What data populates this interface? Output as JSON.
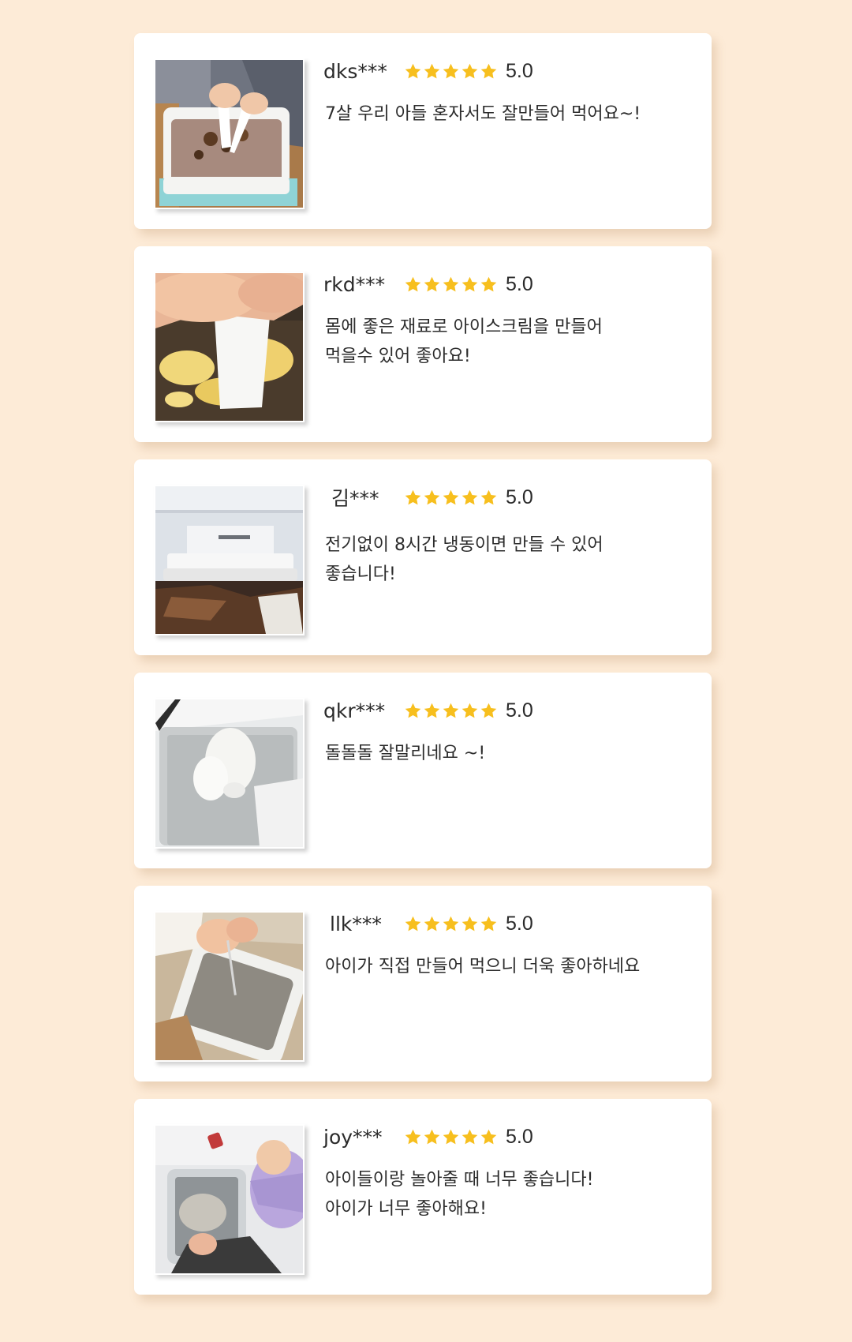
{
  "reviews": [
    {
      "username": "dks***",
      "rating": "5.0",
      "stars": 5,
      "lines": [
        "7살 우리 아들 혼자서도 잘만들어 먹어요~!"
      ],
      "photo": "kids-scooping-chocolate-ice-cream"
    },
    {
      "username": "rkd***",
      "rating": "5.0",
      "stars": 5,
      "lines": [
        "몸에 좋은 재료로 아이스크림을 만들어",
        "먹을수 있어 좋아요!"
      ],
      "photo": "hand-scraping-vanilla-ice-cream"
    },
    {
      "username": "김***",
      "rating": "5.0",
      "stars": 5,
      "lines": [
        "전기없이 8시간 냉동이면 만들 수 있어",
        "좋습니다!"
      ],
      "photo": "tray-in-freezer"
    },
    {
      "username": "qkr***",
      "rating": "5.0",
      "stars": 5,
      "lines": [
        "돌돌돌 잘말리네요 ~!"
      ],
      "photo": "rolled-ice-cream-on-tray"
    },
    {
      "username": "llk***",
      "rating": "5.0",
      "stars": 5,
      "lines": [
        "아이가 직접 만들어 먹으니 더욱 좋아하네요"
      ],
      "photo": "child-making-ice-cream"
    },
    {
      "username": "joy***",
      "rating": "5.0",
      "stars": 5,
      "lines": [
        "아이들이랑 놀아줄 때 너무 좋습니다!",
        "아이가 너무 좋아해요!"
      ],
      "photo": "child-playing-with-tray"
    }
  ],
  "colors": {
    "background": "#fdebd7",
    "card": "#ffffff",
    "star": "#f7bf1e",
    "text": "#2a2a2a"
  }
}
